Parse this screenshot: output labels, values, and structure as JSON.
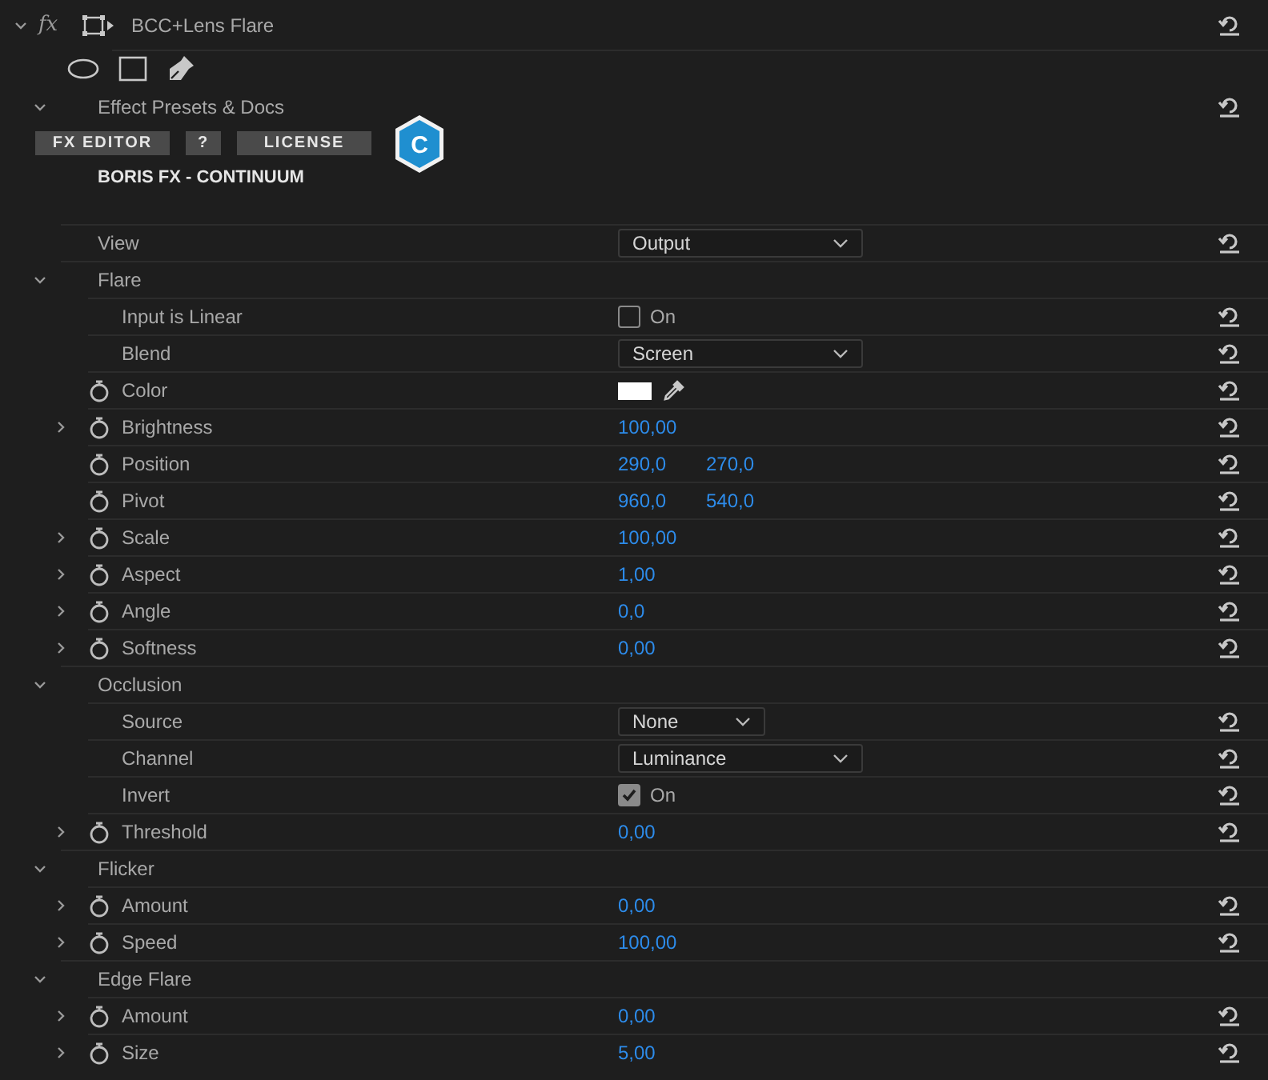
{
  "effect": {
    "fx_label": "fx",
    "title": "BCC+Lens Flare",
    "expanded": true
  },
  "presets": {
    "title": "Effect Presets & Docs",
    "expanded": true,
    "buttons": [
      "FX EDITOR",
      "?",
      "LICENSE"
    ],
    "brand": "BORIS FX - CONTINUUM",
    "logo_letter": "C"
  },
  "params": [
    {
      "kind": "dropdown",
      "label": "View",
      "value": "Output",
      "compact": false
    },
    {
      "kind": "section",
      "label": "Flare",
      "expanded": true,
      "children": [
        {
          "kind": "checkbox",
          "label": "Input is Linear",
          "checked": false,
          "text": "On"
        },
        {
          "kind": "dropdown",
          "label": "Blend",
          "value": "Screen",
          "compact": false
        },
        {
          "kind": "color",
          "label": "Color",
          "animatable": true,
          "color": "#ffffff"
        },
        {
          "kind": "number",
          "label": "Brightness",
          "animatable": true,
          "expanded": false,
          "values": [
            "100,00"
          ]
        },
        {
          "kind": "number",
          "label": "Position",
          "animatable": true,
          "values": [
            "290,0",
            "270,0"
          ]
        },
        {
          "kind": "number",
          "label": "Pivot",
          "animatable": true,
          "values": [
            "960,0",
            "540,0"
          ]
        },
        {
          "kind": "number",
          "label": "Scale",
          "animatable": true,
          "expanded": false,
          "values": [
            "100,00"
          ]
        },
        {
          "kind": "number",
          "label": "Aspect",
          "animatable": true,
          "expanded": false,
          "values": [
            "1,00"
          ]
        },
        {
          "kind": "number",
          "label": "Angle",
          "animatable": true,
          "expanded": false,
          "values": [
            "0,0"
          ]
        },
        {
          "kind": "number",
          "label": "Softness",
          "animatable": true,
          "expanded": false,
          "values": [
            "0,00"
          ]
        }
      ]
    },
    {
      "kind": "section",
      "label": "Occlusion",
      "expanded": true,
      "children": [
        {
          "kind": "dropdown",
          "label": "Source",
          "value": "None",
          "compact": true
        },
        {
          "kind": "dropdown",
          "label": "Channel",
          "value": "Luminance",
          "compact": false
        },
        {
          "kind": "checkbox",
          "label": "Invert",
          "checked": true,
          "text": "On"
        },
        {
          "kind": "number",
          "label": "Threshold",
          "animatable": true,
          "expanded": false,
          "values": [
            "0,00"
          ]
        }
      ]
    },
    {
      "kind": "section",
      "label": "Flicker",
      "expanded": true,
      "children": [
        {
          "kind": "number",
          "label": "Amount",
          "animatable": true,
          "expanded": false,
          "values": [
            "0,00"
          ]
        },
        {
          "kind": "number",
          "label": "Speed",
          "animatable": true,
          "expanded": false,
          "values": [
            "100,00"
          ]
        }
      ]
    },
    {
      "kind": "section",
      "label": "Edge Flare",
      "expanded": true,
      "children": [
        {
          "kind": "number",
          "label": "Amount",
          "animatable": true,
          "expanded": false,
          "values": [
            "0,00"
          ]
        },
        {
          "kind": "number",
          "label": "Size",
          "animatable": true,
          "expanded": false,
          "values": [
            "5,00"
          ]
        }
      ]
    }
  ]
}
